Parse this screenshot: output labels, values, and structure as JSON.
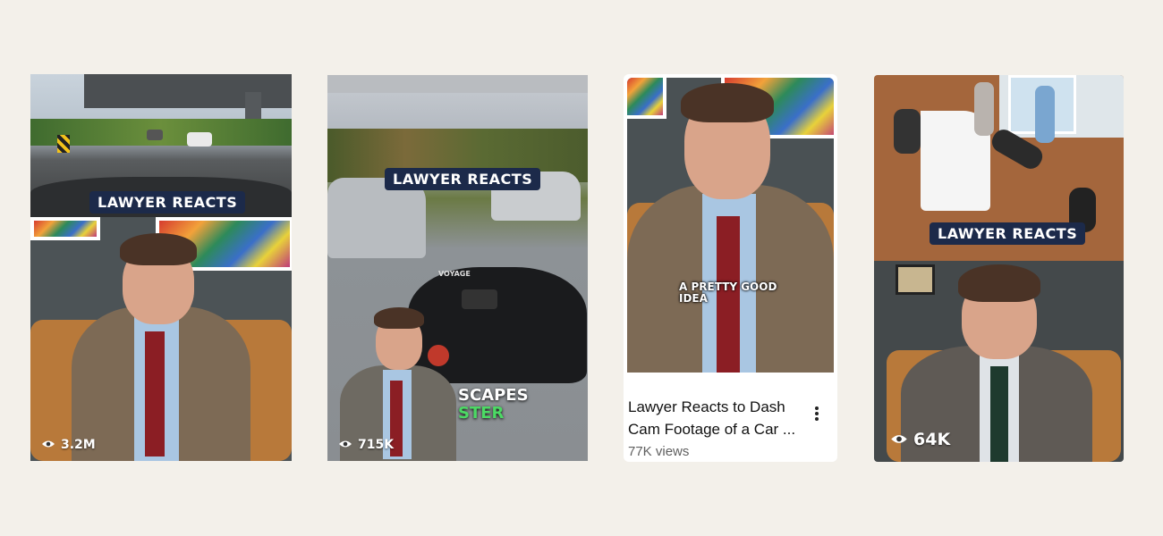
{
  "cards": [
    {
      "overlay": "LAWYER REACTS",
      "views": "3.2M",
      "icon": "eye-icon"
    },
    {
      "overlay": "LAWYER REACTS",
      "caption_a": "SCAPES",
      "caption_b": "STER",
      "gauge_brand": "VOYAGE",
      "views": "715K",
      "icon": "eye-icon"
    },
    {
      "caption": "A PRETTY GOOD IDEA",
      "title_line1": "Lawyer Reacts to Dash",
      "title_line2": "Cam Footage of a Car ...",
      "views": "77K views",
      "menu_icon": "more-vertical-icon"
    },
    {
      "overlay": "LAWYER REACTS",
      "views": "64K",
      "icon": "eye-icon"
    }
  ],
  "colors": {
    "page_bg": "#f3f0ea",
    "pill_bg": "#1c2a4a",
    "caption_green": "#4cd964"
  }
}
